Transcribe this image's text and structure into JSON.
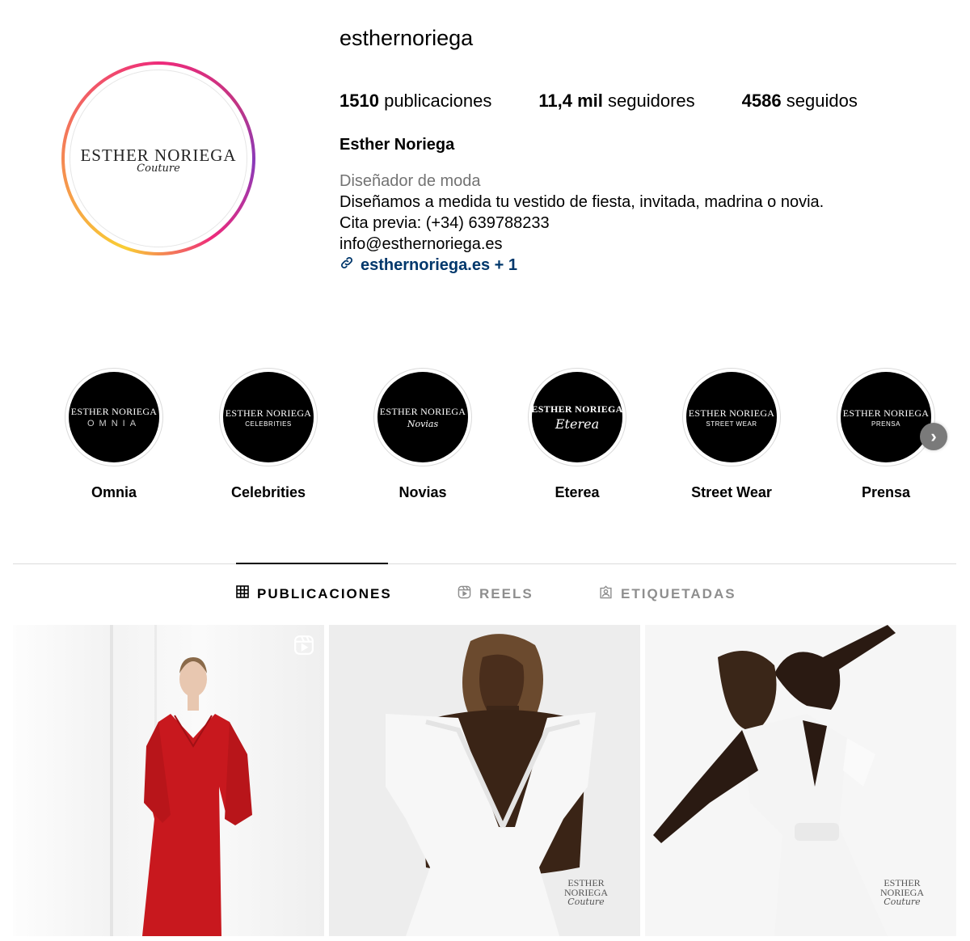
{
  "profile": {
    "username": "esthernoriega",
    "avatar_logo": {
      "main": "ESTHER NORIEGA",
      "sub": "Couture"
    },
    "stats": [
      {
        "value": "1510",
        "label": "publicaciones"
      },
      {
        "value": "11,4 mil",
        "label": "seguidores"
      },
      {
        "value": "4586",
        "label": "seguidos"
      }
    ],
    "full_name": "Esther Noriega",
    "category": "Diseñador de moda",
    "bio_lines": [
      "Diseñamos a medida tu vestido de fiesta, invitada, madrina o novia.",
      "Cita previa: (+34) 639788233",
      "info@esthernoriega.es"
    ],
    "link": "esthernoriega.es + 1"
  },
  "highlights": [
    {
      "label": "Omnia",
      "brand": "ESTHER NORIEGA",
      "sub": "OMNIA"
    },
    {
      "label": "Celebrities",
      "brand": "ESTHER NORIEGA",
      "sub": "CELEBRITIES"
    },
    {
      "label": "Novias",
      "brand": "ESTHER NORIEGA",
      "sub": "Novias"
    },
    {
      "label": "Eterea",
      "brand": "ESTHER NORIEGA",
      "sub": "Eterea"
    },
    {
      "label": "Street Wear",
      "brand": "ESTHER NORIEGA",
      "sub": "STREET WEAR"
    },
    {
      "label": "Prensa",
      "brand": "ESTHER NORIEGA",
      "sub": "PRENSA"
    }
  ],
  "tabs": [
    {
      "label": "PUBLICACIONES",
      "icon": "grid-icon",
      "active": true
    },
    {
      "label": "REELS",
      "icon": "reels-icon",
      "active": false
    },
    {
      "label": "ETIQUETADAS",
      "icon": "tagged-icon",
      "active": false
    }
  ],
  "posts": [
    {
      "type": "reel",
      "watermark": null
    },
    {
      "type": "photo",
      "watermark": {
        "line1": "ESTHER",
        "line2": "NORIEGA",
        "line3": "Couture"
      }
    },
    {
      "type": "photo",
      "watermark": {
        "line1": "ESTHER",
        "line2": "NORIEGA",
        "line3": "Couture"
      }
    }
  ],
  "colors": {
    "link": "#00376b",
    "muted": "#737373",
    "divider": "#dbdbdb",
    "story_ring": [
      "#f9ce34",
      "#ee2a7b",
      "#8a3ab9"
    ]
  }
}
